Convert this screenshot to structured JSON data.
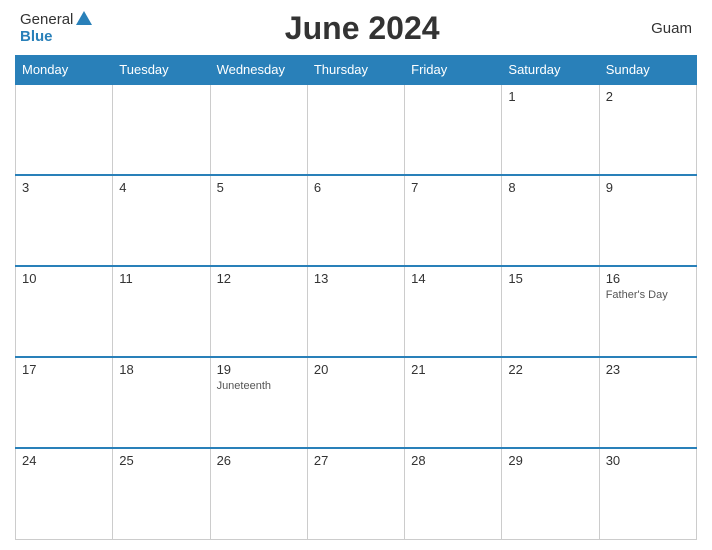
{
  "header": {
    "title": "June 2024",
    "region": "Guam",
    "logo": {
      "general": "General",
      "blue": "Blue"
    }
  },
  "weekdays": [
    "Monday",
    "Tuesday",
    "Wednesday",
    "Thursday",
    "Friday",
    "Saturday",
    "Sunday"
  ],
  "weeks": [
    [
      {
        "day": "",
        "empty": true
      },
      {
        "day": "",
        "empty": true
      },
      {
        "day": "",
        "empty": true
      },
      {
        "day": "",
        "empty": true
      },
      {
        "day": "",
        "empty": true
      },
      {
        "day": "1",
        "event": ""
      },
      {
        "day": "2",
        "event": ""
      }
    ],
    [
      {
        "day": "3",
        "event": ""
      },
      {
        "day": "4",
        "event": ""
      },
      {
        "day": "5",
        "event": ""
      },
      {
        "day": "6",
        "event": ""
      },
      {
        "day": "7",
        "event": ""
      },
      {
        "day": "8",
        "event": ""
      },
      {
        "day": "9",
        "event": ""
      }
    ],
    [
      {
        "day": "10",
        "event": ""
      },
      {
        "day": "11",
        "event": ""
      },
      {
        "day": "12",
        "event": ""
      },
      {
        "day": "13",
        "event": ""
      },
      {
        "day": "14",
        "event": ""
      },
      {
        "day": "15",
        "event": ""
      },
      {
        "day": "16",
        "event": "Father's Day"
      }
    ],
    [
      {
        "day": "17",
        "event": ""
      },
      {
        "day": "18",
        "event": ""
      },
      {
        "day": "19",
        "event": "Juneteenth"
      },
      {
        "day": "20",
        "event": ""
      },
      {
        "day": "21",
        "event": ""
      },
      {
        "day": "22",
        "event": ""
      },
      {
        "day": "23",
        "event": ""
      }
    ],
    [
      {
        "day": "24",
        "event": ""
      },
      {
        "day": "25",
        "event": ""
      },
      {
        "day": "26",
        "event": ""
      },
      {
        "day": "27",
        "event": ""
      },
      {
        "day": "28",
        "event": ""
      },
      {
        "day": "29",
        "event": ""
      },
      {
        "day": "30",
        "event": ""
      }
    ]
  ]
}
